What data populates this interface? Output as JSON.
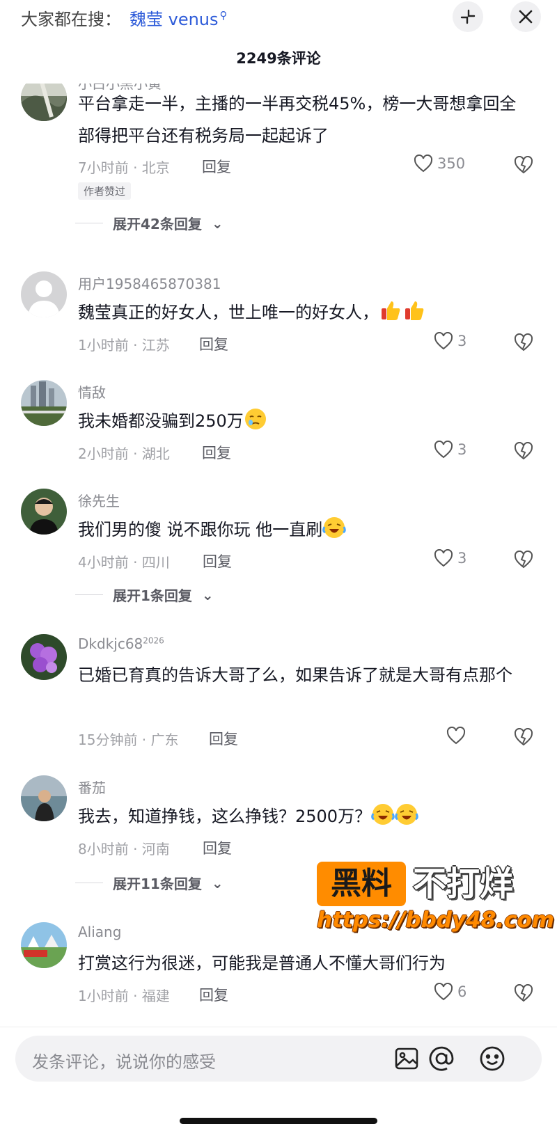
{
  "header": {
    "search_prefix": "大家都在搜：",
    "search_term": "魏莹 venus",
    "comment_count": "2249条评论"
  },
  "comments": [
    {
      "username": "小白小黑小黄",
      "text": "平台拿走一半，主播的一半再交税45%，榜一大哥想拿回全部得把平台还有税务局一起起诉了",
      "meta": "7小时前 · 北京",
      "reply": "回复",
      "likes": "350",
      "badge": "作者赞过",
      "expand": "展开42条回复"
    },
    {
      "username": "用户1958465870381",
      "text": "魏莹真正的好女人，世上唯一的好女人，",
      "meta": "1小时前 · 江苏",
      "reply": "回复",
      "likes": "3"
    },
    {
      "username": "情敌",
      "text": "我未婚都没骗到250万",
      "meta": "2小时前 · 湖北",
      "reply": "回复",
      "likes": "3"
    },
    {
      "username": "徐先生",
      "text": "我们男的傻 说不跟你玩 他一直刷",
      "meta": "4小时前 · 四川",
      "reply": "回复",
      "likes": "3",
      "expand": "展开1条回复"
    },
    {
      "username": "Dkdkjc68",
      "username_sup": "2026",
      "text": "已婚已育真的告诉大哥了么，如果告诉了就是大哥有点那个",
      "meta": "15分钟前 · 广东",
      "reply": "回复",
      "likes": ""
    },
    {
      "username": "番茄",
      "text": "我去，知道挣钱，这么挣钱？2500万？",
      "meta": "8小时前 · 河南",
      "reply": "回复",
      "likes": "",
      "expand": "展开11条回复"
    },
    {
      "username": "Aliang",
      "text": "打赏这行为很迷，可能我是普通人不懂大哥们行为",
      "meta": "1小时前 · 福建",
      "reply": "回复",
      "likes": "6"
    }
  ],
  "watermark": {
    "box": "黑料",
    "side": "不打烊",
    "url": "https://bbdy48.com"
  },
  "input": {
    "placeholder": "发条评论，说说你的感受"
  },
  "icons": {
    "collapse": "collapse-icon",
    "close": "close-icon",
    "like": "heart-icon",
    "dislike": "broken-heart-icon",
    "image": "image-icon",
    "mention": "at-icon",
    "emoji": "smiley-icon"
  },
  "colors": {
    "accent_link": "#2d5bd9",
    "watermark_orange": "#ff8c00"
  }
}
